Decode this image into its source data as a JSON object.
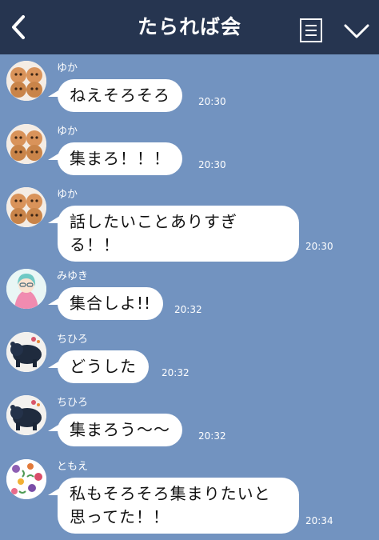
{
  "header": {
    "title": "たられば会"
  },
  "icons": {
    "back": "chevron-left-icon",
    "menu": "document-list-icon",
    "collapse": "chevron-down-icon"
  },
  "colors": {
    "header_bg": "#263550",
    "chat_bg": "#7293c0",
    "bubble_bg": "#ffffff"
  },
  "messages": [
    {
      "sender": "ゆか",
      "text": "ねえそろそろ",
      "time": "20:30"
    },
    {
      "sender": "ゆか",
      "text": "集まろ！！！",
      "time": "20:30"
    },
    {
      "sender": "ゆか",
      "text": "話したいことありすぎる！！",
      "time": "20:30"
    },
    {
      "sender": "みゆき",
      "text": "集合しよ!!",
      "time": "20:32"
    },
    {
      "sender": "ちひろ",
      "text": "どうした",
      "time": "20:32"
    },
    {
      "sender": "ちひろ",
      "text": "集まろう〜〜",
      "time": "20:32"
    },
    {
      "sender": "ともえ",
      "text": "私もそろそろ集まりたいと思ってた！！",
      "time": "20:34"
    }
  ]
}
